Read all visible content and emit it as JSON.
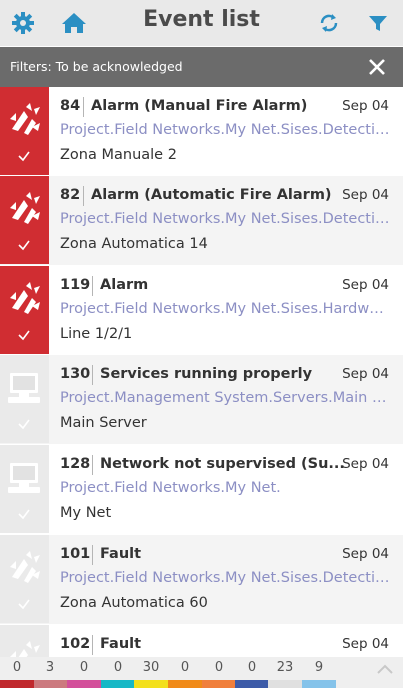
{
  "header": {
    "title": "Event list",
    "left_icons": [
      "gear-icon",
      "home-icon"
    ],
    "right_icons": [
      "refresh-icon",
      "filter-icon"
    ],
    "icon_color": "#2b8fc3"
  },
  "filter": {
    "text": "Filters: To be acknowledged",
    "close_icon": "close-icon"
  },
  "events": [
    {
      "id": "84",
      "title": "Alarm (Manual Fire Alarm)",
      "date": "Sep 04",
      "path": "Project.Field Networks.My Net.Sises.Detection...",
      "location": "Zona Manuale 2",
      "category": "fire",
      "state": "active"
    },
    {
      "id": "82",
      "title": "Alarm (Automatic Fire Alarm)",
      "date": "Sep 04",
      "path": "Project.Field Networks.My Net.Sises.Detection...",
      "location": "Zona Automatica 14",
      "category": "fire",
      "state": "active"
    },
    {
      "id": "119",
      "title": "Alarm",
      "date": "Sep 04",
      "path": "Project.Field Networks.My Net.Sises.Hardware...",
      "location": "Line 1/2/1",
      "category": "fire",
      "state": "active"
    },
    {
      "id": "130",
      "title": "Services running properly",
      "date": "Sep 04",
      "path": "Project.Management System.Servers.Main Ser...",
      "location": "Main Server",
      "category": "computer",
      "state": "inactive"
    },
    {
      "id": "128",
      "title": "Network not supervised (Su...",
      "date": "Sep 04",
      "path": "Project.Field Networks.My Net.",
      "location": "My Net",
      "category": "computer",
      "state": "inactive"
    },
    {
      "id": "101",
      "title": "Fault",
      "date": "Sep 04",
      "path": "Project.Field Networks.My Net.Sises.Detection...",
      "location": "Zona Automatica 60",
      "category": "fire",
      "state": "inactive"
    },
    {
      "id": "102",
      "title": "Fault",
      "date": "Sep 04",
      "path": "",
      "location": "",
      "category": "fire",
      "state": "inactive"
    }
  ],
  "footer": {
    "counts": [
      "0",
      "3",
      "0",
      "0",
      "30",
      "0",
      "0",
      "0",
      "23",
      "9"
    ],
    "colors": [
      "#c0282d",
      "#cc7a7f",
      "#d34f9a",
      "#17b8c6",
      "#f3e01c",
      "#f08a18",
      "#f07f3c",
      "#3d5ba8",
      "#e0e0e0",
      "#85c3ea"
    ],
    "expand_icon": "chevron-up-icon"
  }
}
